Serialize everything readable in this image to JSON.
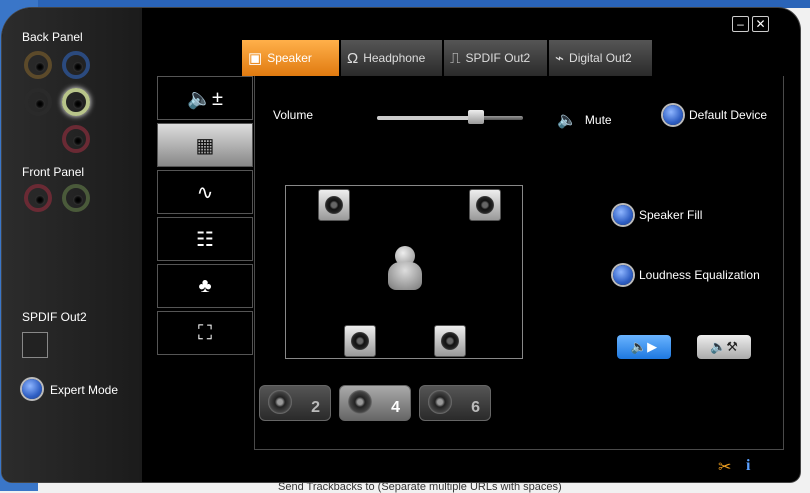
{
  "left_panel": {
    "back_panel_label": "Back Panel",
    "front_panel_label": "Front Panel",
    "spdif_label": "SPDIF Out2",
    "expert_mode_label": "Expert Mode"
  },
  "tabs": [
    {
      "label": "Speaker",
      "icon": "speaker-icon",
      "active": true
    },
    {
      "label": "Headphone",
      "icon": "headphone-icon",
      "active": false
    },
    {
      "label": "SPDIF Out2",
      "icon": "spdif-icon",
      "active": false
    },
    {
      "label": "Digital Out2",
      "icon": "digital-out-icon",
      "active": false
    }
  ],
  "sidebar": [
    {
      "name": "volume-levels",
      "icon": "speaker-plus-minus-icon"
    },
    {
      "name": "speaker-config",
      "icon": "surround-speakers-icon",
      "active": true
    },
    {
      "name": "sound-effects",
      "icon": "waveform-icon"
    },
    {
      "name": "equalizer",
      "icon": "equalizer-icon"
    },
    {
      "name": "environment",
      "icon": "environment-icon"
    },
    {
      "name": "room-correction",
      "icon": "room-correction-icon"
    }
  ],
  "main": {
    "volume_label": "Volume",
    "volume_level": 0.68,
    "mute_label": "Mute",
    "default_device_label": "Default Device",
    "speaker_fill_label": "Speaker Fill",
    "loudness_eq_label": "Loudness Equalization"
  },
  "channel_configs": [
    {
      "label": "2",
      "active": false
    },
    {
      "label": "4",
      "active": true
    },
    {
      "label": "6",
      "active": false
    }
  ],
  "status_text": "Send Trackbacks to (Separate multiple URLs with spaces)",
  "colors": {
    "active_tab": "#f08a1c",
    "radio_blue": "#2f5fc4",
    "test_button": "#1e78e0"
  }
}
